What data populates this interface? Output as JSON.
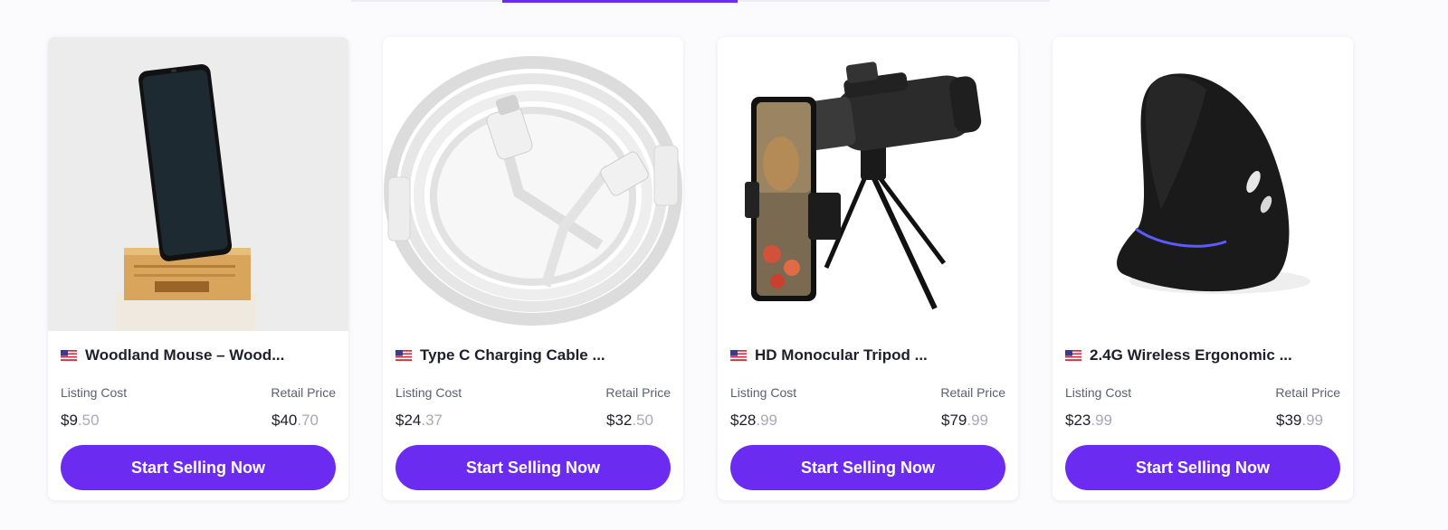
{
  "products": [
    {
      "title": "Woodland Mouse – Wood...",
      "listing_label": "Listing Cost",
      "retail_label": "Retail Price",
      "listing_dollars": "$9",
      "listing_cents": ".50",
      "retail_dollars": "$40",
      "retail_cents": ".70",
      "button": "Start Selling Now",
      "flag_icon": "us-flag-icon",
      "image_icon": "phone-on-wooden-stand-image"
    },
    {
      "title": "Type C Charging Cable ...",
      "listing_label": "Listing Cost",
      "retail_label": "Retail Price",
      "listing_dollars": "$24",
      "listing_cents": ".37",
      "retail_dollars": "$32",
      "retail_cents": ".50",
      "button": "Start Selling Now",
      "flag_icon": "us-flag-icon",
      "image_icon": "white-usb-c-cable-image"
    },
    {
      "title": "HD Monocular Tripod  ...",
      "listing_label": "Listing Cost",
      "retail_label": "Retail Price",
      "listing_dollars": "$28",
      "listing_cents": ".99",
      "retail_dollars": "$79",
      "retail_cents": ".99",
      "button": "Start Selling Now",
      "flag_icon": "us-flag-icon",
      "image_icon": "monocular-tripod-image"
    },
    {
      "title": "2.4G Wireless Ergonomic ...",
      "listing_label": "Listing Cost",
      "retail_label": "Retail Price",
      "listing_dollars": "$23",
      "listing_cents": ".99",
      "retail_dollars": "$39",
      "retail_cents": ".99",
      "button": "Start Selling Now",
      "flag_icon": "us-flag-icon",
      "image_icon": "vertical-ergonomic-mouse-image"
    }
  ],
  "colors": {
    "accent": "#6c2bf1",
    "text": "#1f1f2b",
    "muted": "#5b6070",
    "cents": "#a9a9b6"
  }
}
